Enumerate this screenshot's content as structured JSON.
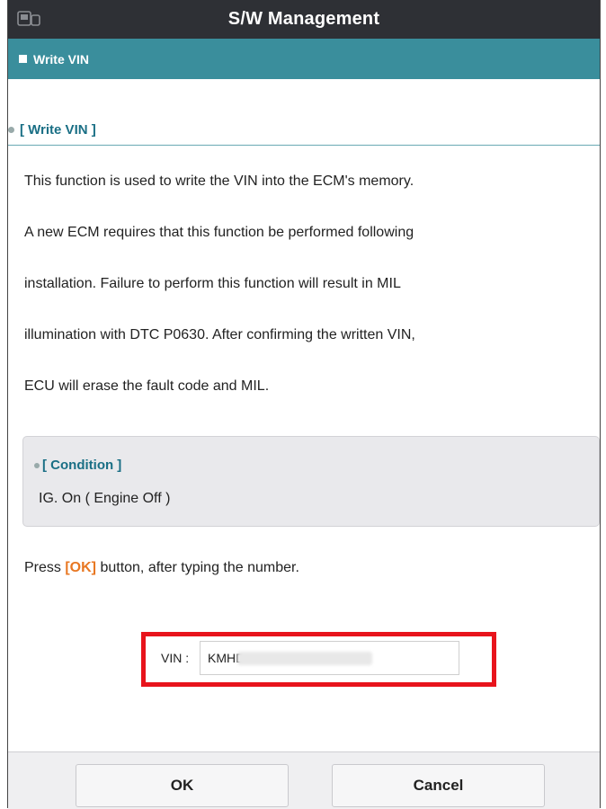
{
  "window": {
    "title": "S/W Management",
    "icon": "tablet-car-icon"
  },
  "subheader": {
    "title": "Write VIN"
  },
  "section": {
    "title": "[ Write VIN ]"
  },
  "description": [
    "This function is used to write the VIN into the ECM's memory.",
    "A new ECM requires that this function be performed following",
    "installation. Failure to perform this function will result in MIL",
    "illumination with DTC P0630. After confirming the written VIN,",
    "ECU will erase the fault code and MIL."
  ],
  "condition": {
    "title": "[ Condition ]",
    "text": "IG. On ( Engine Off )"
  },
  "instruction": {
    "prefix": "Press ",
    "ok_tag": "[OK]",
    "suffix": " button, after typing the number."
  },
  "vin": {
    "label": "VIN :",
    "value": "KMHD"
  },
  "buttons": {
    "ok": "OK",
    "cancel": "Cancel"
  },
  "colors": {
    "titlebar": "#2e3035",
    "subbar": "#3a8e9c",
    "highlight": "#e8141c",
    "ok_tag": "#e87722"
  }
}
